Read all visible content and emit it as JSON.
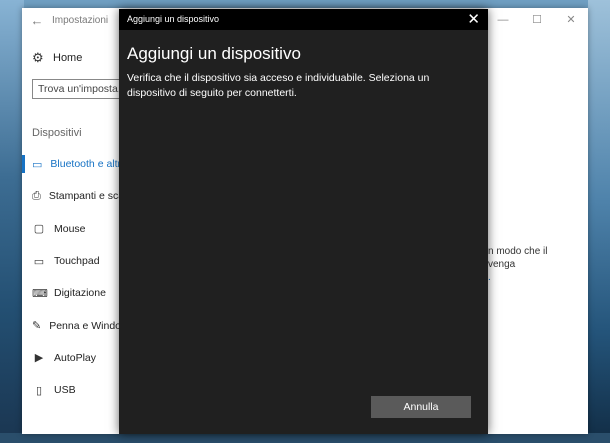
{
  "settings": {
    "title": "Impostazioni",
    "home_label": "Home",
    "search_placeholder": "Trova un'imposta...",
    "section_label": "Dispositivi",
    "nav": [
      {
        "label": "Bluetooth e altri",
        "icon": "bluetooth-icon"
      },
      {
        "label": "Stampanti e scanner",
        "icon": "printer-icon"
      },
      {
        "label": "Mouse",
        "icon": "mouse-icon"
      },
      {
        "label": "Touchpad",
        "icon": "touchpad-icon"
      },
      {
        "label": "Digitazione",
        "icon": "keyboard-icon"
      },
      {
        "label": "Penna e Windows Ink",
        "icon": "pen-icon"
      },
      {
        "label": "AutoPlay",
        "icon": "autoplay-icon"
      },
      {
        "label": "USB",
        "icon": "usb-icon"
      }
    ],
    "right_text": [
      "n modo che il",
      "venga",
      "."
    ]
  },
  "dialog": {
    "title": "Aggiungi un dispositivo",
    "heading": "Aggiungi un dispositivo",
    "description": "Verifica che il dispositivo sia acceso e individuabile. Seleziona un dispositivo di seguito per connetterti.",
    "cancel_label": "Annulla"
  }
}
